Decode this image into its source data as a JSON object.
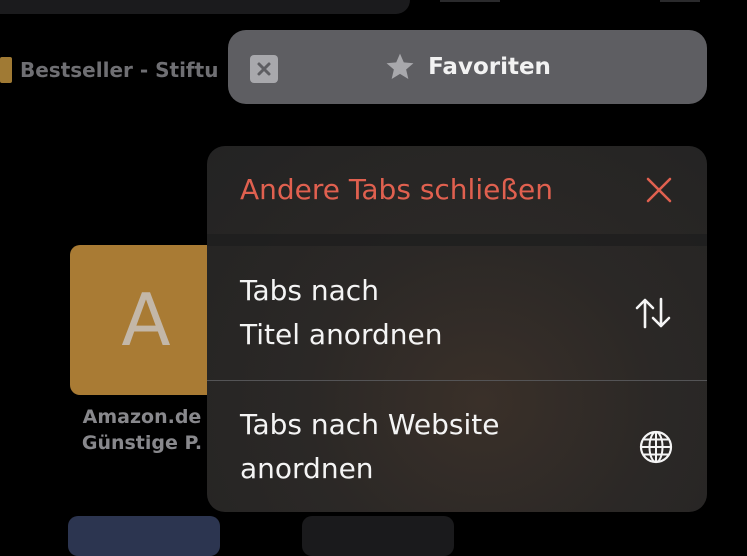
{
  "background": {
    "bookmark_label": "Bestseller - Stiftu",
    "tile_letter": "A",
    "tile_caption_line1": "Amazon.de",
    "tile_caption_line2": "Günstige P."
  },
  "tab": {
    "title": "Favoriten",
    "close_icon": "close-icon",
    "favorites_icon": "star-icon"
  },
  "menu": {
    "close_others": {
      "label": "Andere Tabs schließen",
      "icon": "xmark-icon"
    },
    "sort_by_title": {
      "line1": "Tabs nach",
      "line2": "Titel anordnen",
      "icon": "arrow-up-down-icon"
    },
    "sort_by_website": {
      "line1": "Tabs nach Website",
      "line2": "anordnen",
      "icon": "globe-icon"
    }
  },
  "colors": {
    "destructive": "#e0604f",
    "tile": "#a97b34",
    "pill": "#5e5e62"
  }
}
